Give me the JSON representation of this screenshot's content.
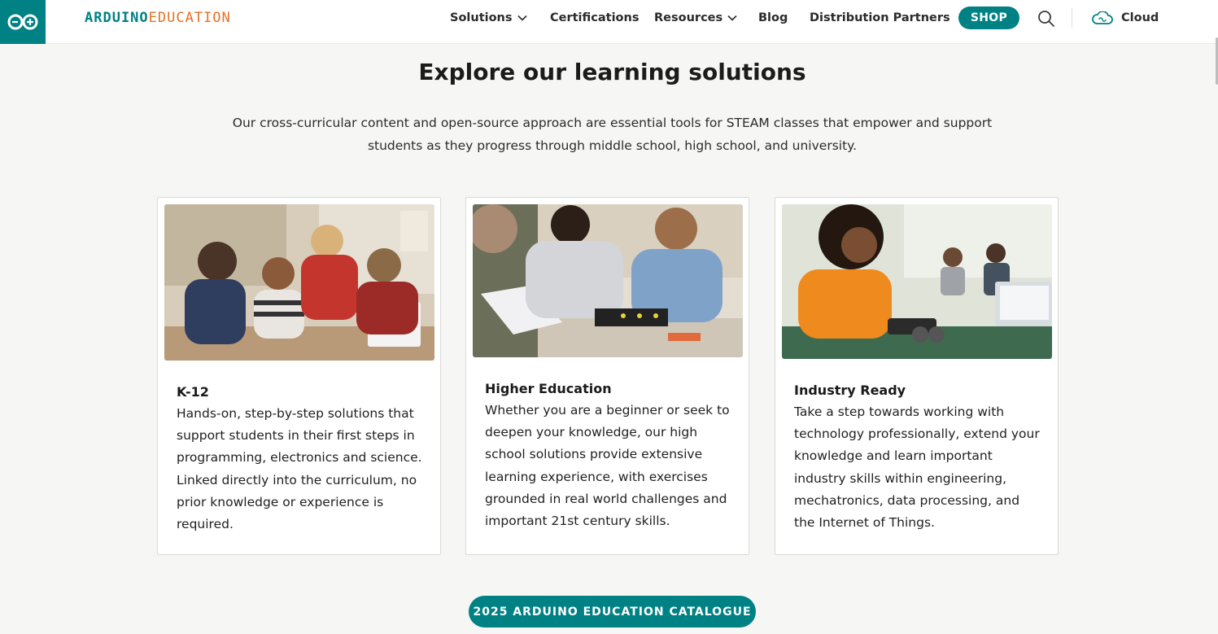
{
  "header": {
    "brand_part1": "ARDUINO",
    "brand_part2": "EDUCATION",
    "nav": [
      {
        "label": "Solutions",
        "has_dropdown": true
      },
      {
        "label": "Certifications",
        "has_dropdown": false
      },
      {
        "label": "Resources",
        "has_dropdown": true
      },
      {
        "label": "Blog",
        "has_dropdown": false
      },
      {
        "label": "Distribution Partners",
        "has_dropdown": false
      }
    ],
    "shop_label": "SHOP",
    "cloud_label": "Cloud",
    "icons": [
      "arduino-logo-icon",
      "chevron-down-icon",
      "search-icon",
      "cloud-icon"
    ]
  },
  "main": {
    "heading": "Explore our learning solutions",
    "intro_line1": "Our cross-curricular content and open-source approach are essential tools for STEAM classes that empower and support",
    "intro_line2": "students as they progress through middle school, high school, and university.",
    "cards": [
      {
        "title": "K-12",
        "description": "Hands-on, step-by-step solutions that support students in their first steps in programming, electronics and science. Linked directly into the curriculum, no prior knowledge or experience is required."
      },
      {
        "title": "Higher Education",
        "description": "Whether you are a beginner or seek to deepen your knowledge, our high school solutions provide extensive learning experience, with exercises grounded in real world challenges and important 21st century skills."
      },
      {
        "title": "Industry Ready",
        "description": "Take a step towards working with technology professionally, extend your knowledge and learn important industry skills within engineering, mechatronics, data processing, and the Internet of Things."
      }
    ],
    "cta_label": "2025 ARDUINO EDUCATION CATALOGUE"
  },
  "colors": {
    "brand_teal": "#008184",
    "brand_orange": "#e47128",
    "page_background": "#f6f6f4"
  }
}
